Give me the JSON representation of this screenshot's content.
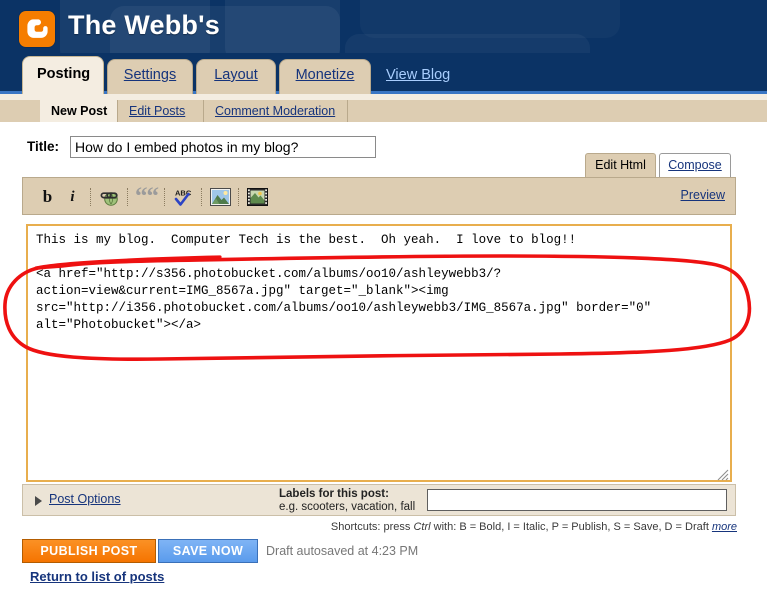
{
  "header": {
    "blog_title": "The Webb's",
    "logo_icon": "blogger-b-logo",
    "background_color": "#0b3365"
  },
  "main_tabs": [
    {
      "label": "Posting",
      "active": true
    },
    {
      "label": "Settings",
      "active": false
    },
    {
      "label": "Layout",
      "active": false
    },
    {
      "label": "Monetize",
      "active": false
    }
  ],
  "view_blog_link": "View Blog",
  "sub_tabs": [
    {
      "label": "New Post",
      "active": true
    },
    {
      "label": "Edit Posts",
      "active": false
    },
    {
      "label": "Comment Moderation",
      "active": false
    }
  ],
  "title_row": {
    "label": "Title:",
    "value": "How do I embed photos in my blog?",
    "placeholder": ""
  },
  "editor_mode_tabs": {
    "edit_html": "Edit Html",
    "compose": "Compose",
    "preview": "Preview"
  },
  "toolbar": [
    {
      "name": "bold-icon",
      "glyph": "b",
      "title": "Bold"
    },
    {
      "name": "italic-icon",
      "glyph": "i",
      "title": "Italic"
    },
    {
      "name": "link-icon",
      "glyph": "",
      "title": "Link"
    },
    {
      "name": "blockquote-icon",
      "glyph": "““",
      "title": "Blockquote"
    },
    {
      "name": "spellcheck-icon",
      "glyph": "ABC",
      "title": "Check Spelling"
    },
    {
      "name": "insert-image-icon",
      "glyph": "",
      "title": "Add Image"
    },
    {
      "name": "insert-video-icon",
      "glyph": "",
      "title": "Add Video"
    }
  ],
  "post_body": "This is my blog.  Computer Tech is the best.  Oh yeah.  I love to blog!!\n\n<a href=\"http://s356.photobucket.com/albums/oo10/ashleywebb3/?\naction=view&current=IMG_8567a.jpg\" target=\"_blank\"><img\nsrc=\"http://i356.photobucket.com/albums/oo10/ashleywebb3/IMG_8567a.jpg\" border=\"0\"\nalt=\"Photobucket\"></a>",
  "options_bar": {
    "post_options_label": "Post Options",
    "labels_heading": "Labels for this post:",
    "labels_example": "e.g. scooters, vacation, fall",
    "labels_value": "",
    "labels_placeholder": ""
  },
  "shortcuts": {
    "prefix": "Shortcuts: press ",
    "ctrl": "Ctrl",
    "with": " with: ",
    "items": "B = Bold, I = Italic, P = Publish, S = Save, D = Draft",
    "more": "more"
  },
  "actions": {
    "publish_label": "PUBLISH POST",
    "save_label": "SAVE NOW",
    "autosave_status": "Draft autosaved at 4:23 PM",
    "return_link": "Return to list of posts"
  },
  "annotation": {
    "shape": "hand-drawn-red-ellipse",
    "color": "#ee1111",
    "target": "photobucket html embed code"
  },
  "colors": {
    "header_blue": "#0b3365",
    "tab_tan": "#ddcdb2",
    "tab_active": "#f4ede1",
    "link_blue": "#16347c",
    "publish_orange": "#f57400",
    "save_blue": "#5a9bec",
    "textarea_border": "#e8ae4e",
    "annotation_red": "#ee1111"
  }
}
